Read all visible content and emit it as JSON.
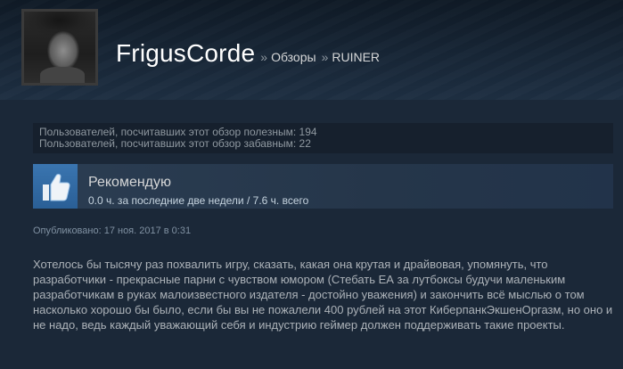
{
  "header": {
    "username": "FrigusCorde",
    "separator": "»",
    "breadcrumb_reviews": "Обзоры",
    "breadcrumb_game": "RUINER"
  },
  "stats": {
    "helpful": "Пользователей, посчитавших этот обзор полезным: 194",
    "funny": "Пользователей, посчитавших этот обзор забавным: 22"
  },
  "review": {
    "recommendation_icon": "thumbs-up-icon",
    "recommendation": "Рекомендую",
    "playtime": "0.0 ч. за последние две недели / 7.6 ч. всего",
    "posted": "Опубликовано: 17 ноя. 2017 в 0:31",
    "body": "Хотелось бы тысячу раз похвалить игру, сказать, какая она крутая и драйвовая, упомянуть, что разработчики - прекрасные парни с чувством юмором (Стебать ЕА за лутбоксы будучи маленьким разработчикам в руках малоизвестного издателя - достойно уважения) и закончить всё мыслью о том насколько хорошо бы было, если бы вы не пожалели 400 рублей на этот КиберпанкЭкшенОргазм, но оно и не надо, ведь каждый уважающий себя и индустрию геймер должен поддерживать такие проекты."
  },
  "colors": {
    "background": "#1b2838",
    "username": "#ffffff",
    "thumb_box": "#3a75b0"
  }
}
